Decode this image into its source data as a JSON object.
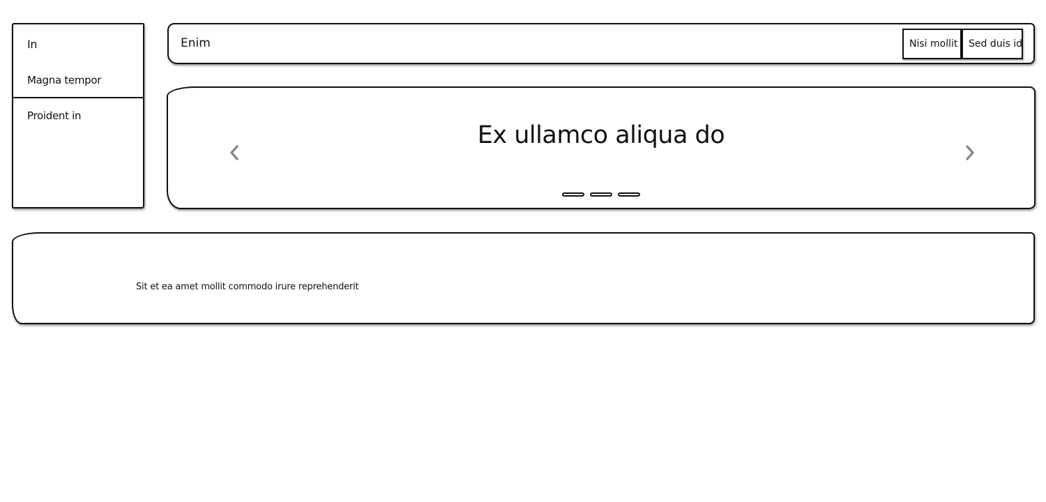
{
  "sidebar": {
    "items": [
      {
        "label": "In"
      },
      {
        "label": "Magna tempor"
      },
      {
        "label": "Proident in"
      }
    ]
  },
  "header": {
    "title": "Enim",
    "buttons": [
      {
        "label": "Nisi mollit"
      },
      {
        "label": "Sed duis id"
      }
    ]
  },
  "carousel": {
    "title": "Ex ullamco aliqua do",
    "prev_icon": "chevron-left-icon",
    "next_icon": "chevron-right-icon",
    "arrow_color": "#8a8a8a"
  },
  "bottom_panel": {
    "text": "Sit et ea amet mollit commodo irure reprehenderit"
  }
}
